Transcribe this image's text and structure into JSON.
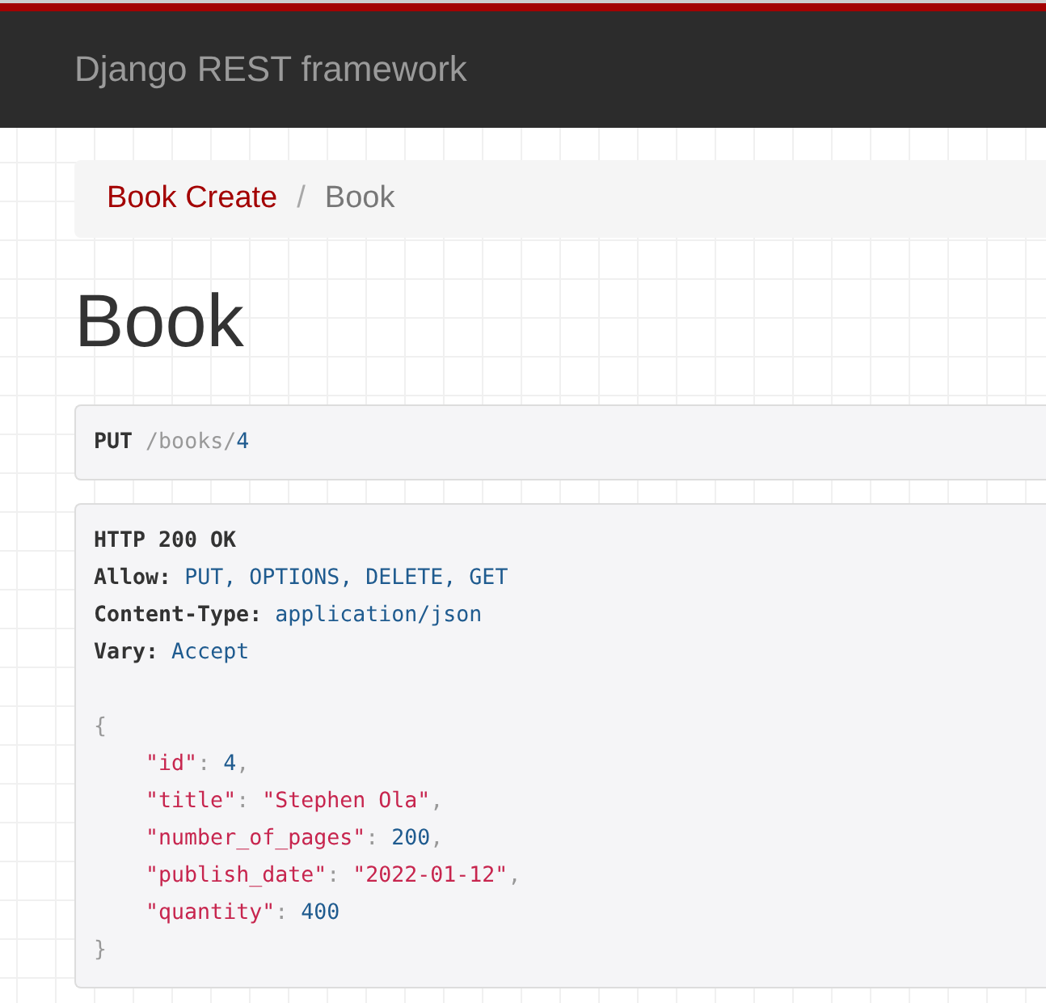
{
  "navbar": {
    "brand": "Django REST framework"
  },
  "breadcrumbs": [
    {
      "label": "Book Create",
      "selected": false
    },
    {
      "label": "/",
      "kind": "separator"
    },
    {
      "label": "Book",
      "selected": true
    }
  ],
  "heading": "Book",
  "request": {
    "method": "PUT",
    "path": "/books/",
    "id": "4"
  },
  "response": {
    "status": "HTTP 200 OK",
    "headers": [
      {
        "name": "Allow:",
        "value": "PUT, OPTIONS, DELETE, GET"
      },
      {
        "name": "Content-Type:",
        "value": "application/json"
      },
      {
        "name": "Vary:",
        "value": "Accept"
      }
    ],
    "open": "{",
    "close": "}",
    "fields": [
      {
        "key": "\"id\"",
        "colon": ": ",
        "value": "4",
        "kind": "number",
        "comma": ","
      },
      {
        "key": "\"title\"",
        "colon": ": ",
        "value": "\"Stephen Ola\"",
        "kind": "string",
        "comma": ","
      },
      {
        "key": "\"number_of_pages\"",
        "colon": ": ",
        "value": "200",
        "kind": "number",
        "comma": ","
      },
      {
        "key": "\"publish_date\"",
        "colon": ": ",
        "value": "\"2022-01-12\"",
        "kind": "string",
        "comma": ","
      },
      {
        "key": "\"quantity\"",
        "colon": ": ",
        "value": "400",
        "kind": "number"
      }
    ]
  }
}
